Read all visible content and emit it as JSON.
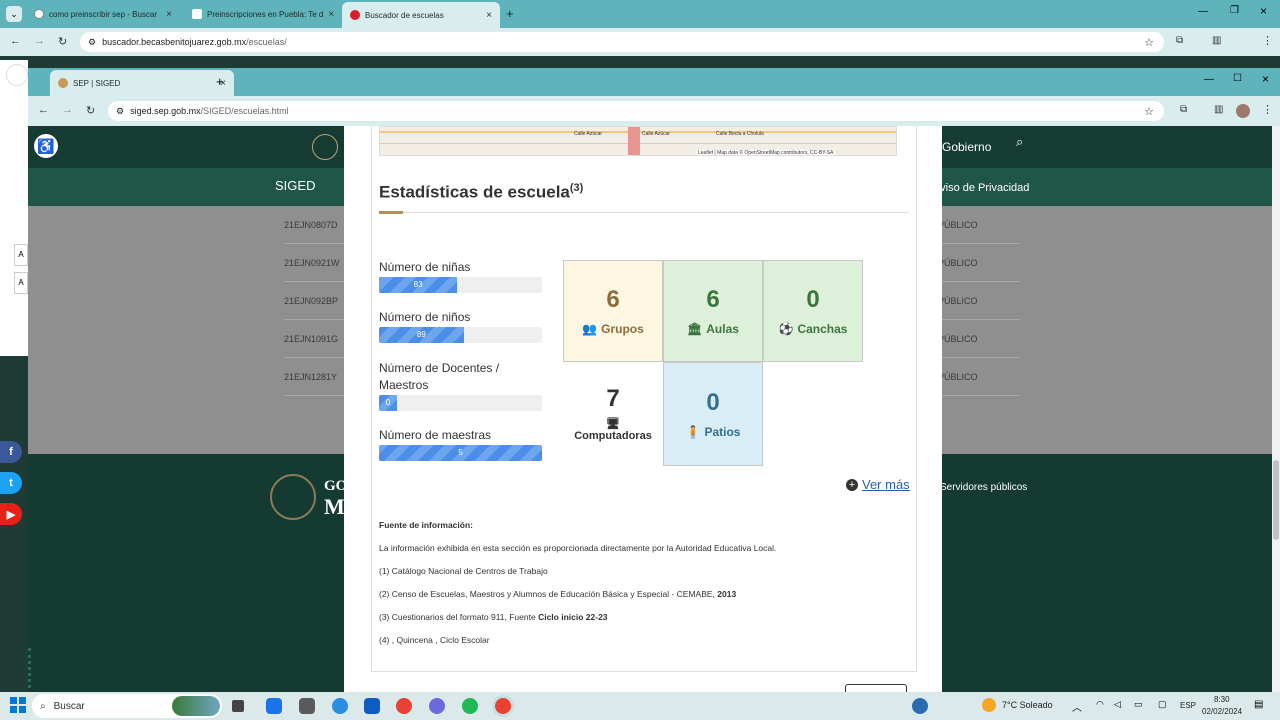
{
  "outer_browser": {
    "tabs": [
      {
        "title": "como preinscribir sep - Buscar"
      },
      {
        "title": "Preinscripciones en Puebla: Te d"
      },
      {
        "title": "Buscador de escuelas"
      }
    ],
    "url_main": "buscador.becasbenitojuarez.gob.mx",
    "url_path": "/escuelas/"
  },
  "inner_browser": {
    "tab_title": "SEP | SIGED",
    "url_main": "siged.sep.gob.mx",
    "url_path": "/SIGED/escuelas.html"
  },
  "site": {
    "nav_siged": "SIGED",
    "nav_gobierno": "Gobierno",
    "nav_privacidad": "Aviso de Privacidad",
    "rows": [
      "21EJN0807D",
      "21EJN0921W",
      "21EJN092BP",
      "21EJN1091G",
      "21EJN1281Y"
    ],
    "row_right": "PÚBLICO",
    "footer_servidores": "Servidores públicos",
    "footer_go": "GO",
    "footer_m": "M",
    "side_labels": [
      "A",
      "A"
    ]
  },
  "map": {
    "labels": [
      "Calle Azúcar",
      "Calle Azúcar",
      "Calle Becla a Cholula"
    ],
    "attribution": "Leaflet | Map data © OpenStreetMap contributors, CC-BY-SA"
  },
  "stats": {
    "title": "Estadísticas de escuela",
    "title_sup": "(3)",
    "bars": [
      {
        "label": "Número de niñas",
        "value": "83",
        "fraction": 0.48
      },
      {
        "label": "Número de niños",
        "value": "89",
        "fraction": 0.52
      },
      {
        "label": "Número de Docentes / Maestros",
        "value": "0",
        "fraction": 0.11
      },
      {
        "label": "Número de maestras",
        "value": "5",
        "fraction": 1.0
      }
    ],
    "boxes": [
      {
        "value": "6",
        "label": "Grupos",
        "icon": "users-icon",
        "bg": "#fdf6e1",
        "color": "#8c6d3e"
      },
      {
        "value": "6",
        "label": "Aulas",
        "icon": "building-icon",
        "bg": "#ddf0d9",
        "color": "#3c763d"
      },
      {
        "value": "0",
        "label": "Canchas",
        "icon": "soccer-ball-icon",
        "bg": "#ddf0d9",
        "color": "#3c763d"
      },
      {
        "value": "7",
        "label": "Computadoras",
        "icon": "desktop-icon",
        "bg": "#ffffff",
        "color": "#333333"
      },
      {
        "value": "0",
        "label": "Patios",
        "icon": "child-icon",
        "bg": "#d9edf7",
        "color": "#31708f"
      }
    ],
    "ver_mas": "Ver más"
  },
  "sources": {
    "heading": "Fuente de información:",
    "intro": "La información exhibida en esta sección es proporcionada directamente por la Autoridad Educativa Local.",
    "items": [
      {
        "text": "(1) Catálogo Nacional de Centros de Trabajo",
        "bold": ""
      },
      {
        "text": "(2) Censo de Escuelas, Maestros y Alumnos de Educación Básica y Especial - CEMABE, ",
        "bold": "2013"
      },
      {
        "text": "(3) Cuestionarios del formato 911, Fuente ",
        "bold": "Ciclo inicio 22-23"
      },
      {
        "text": "(4) , Quincena , Ciclo Escolar",
        "bold": ""
      }
    ]
  },
  "taskbar": {
    "search": "Buscar",
    "weather": "7°C  Soleado",
    "lang": "ESP",
    "time": "8:30",
    "date": "02/02/2024"
  }
}
